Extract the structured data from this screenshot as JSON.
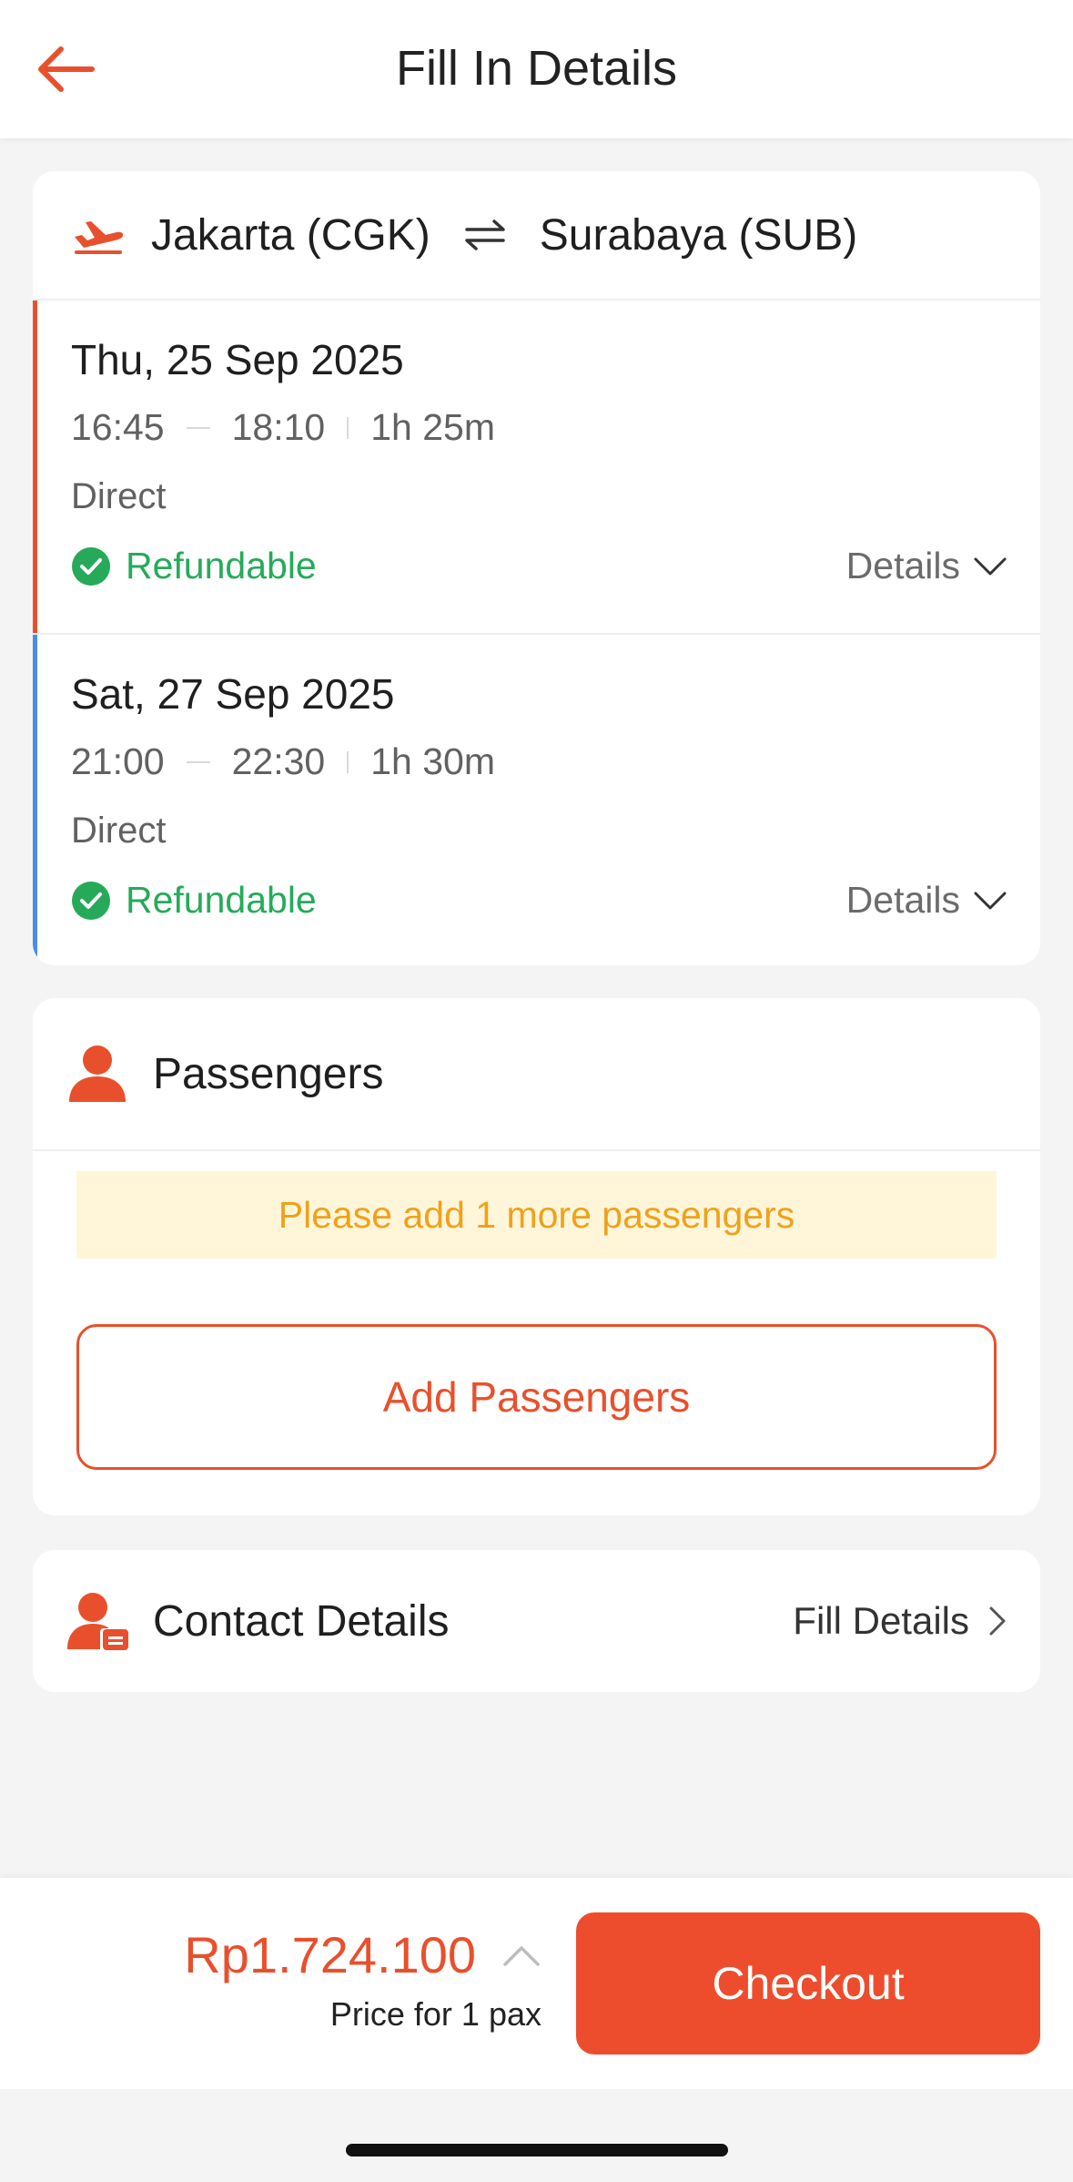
{
  "header": {
    "title": "Fill In Details",
    "back_icon": "arrow-left-icon"
  },
  "colors": {
    "accent": "#ee4d2d",
    "success": "#26aa5a",
    "notice_text": "#f0a11a",
    "notice_bg": "#fff6da",
    "outbound_bar": "#e8502d",
    "return_bar": "#4a8ee8"
  },
  "flight": {
    "origin": "Jakarta (CGK)",
    "destination": "Surabaya (SUB)",
    "legs": [
      {
        "date": "Thu, 25 Sep 2025",
        "depart": "16:45",
        "arrive": "18:10",
        "duration": "1h 25m",
        "stops": "Direct",
        "refund_label": "Refundable",
        "details_label": "Details"
      },
      {
        "date": "Sat, 27 Sep 2025",
        "depart": "21:00",
        "arrive": "22:30",
        "duration": "1h 30m",
        "stops": "Direct",
        "refund_label": "Refundable",
        "details_label": "Details"
      }
    ]
  },
  "passengers": {
    "title": "Passengers",
    "notice": "Please add 1 more passengers",
    "add_button": "Add Passengers"
  },
  "contact": {
    "title": "Contact Details",
    "action": "Fill Details"
  },
  "footer": {
    "price": "Rp1.724.100",
    "price_note": "Price for 1 pax",
    "checkout": "Checkout"
  }
}
